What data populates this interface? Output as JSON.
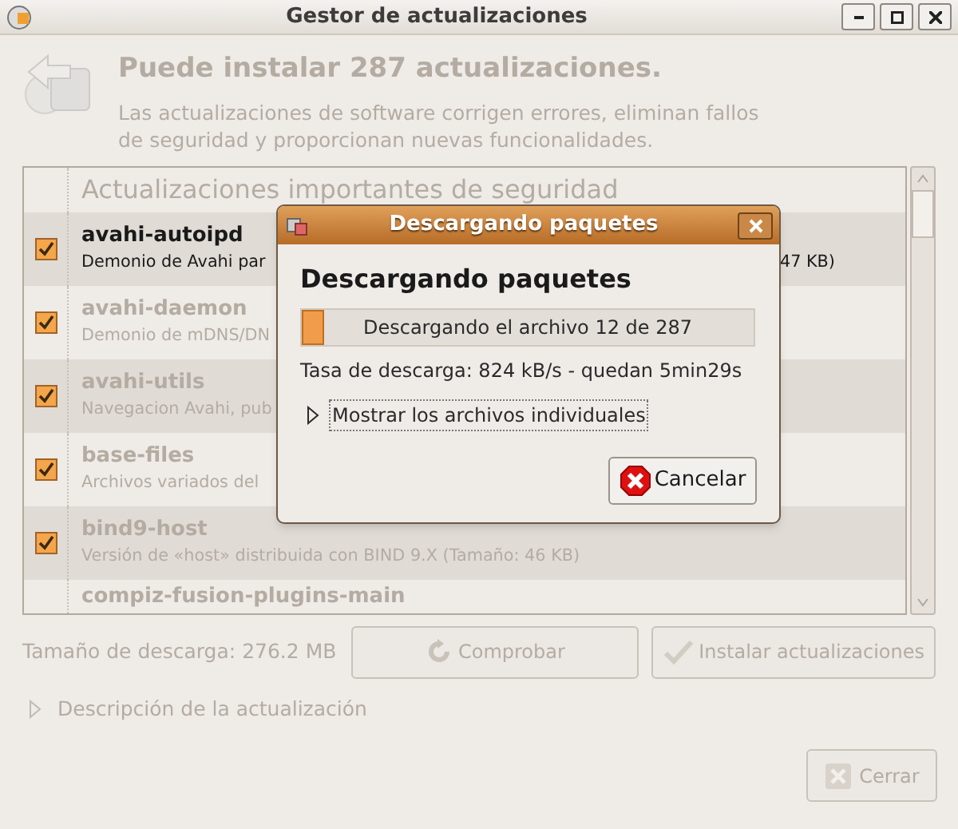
{
  "window": {
    "title": "Gestor de actualizaciones"
  },
  "header": {
    "title": "Puede instalar 287 actualizaciones.",
    "text": "Las actualizaciones de software corrigen errores, eliminan fallos de seguridad y proporcionan nuevas funcionalidades."
  },
  "update_list": {
    "group": "Actualizaciones importantes de seguridad",
    "rows": [
      {
        "name": "avahi-autoipd",
        "description": "Demonio de Avahi par",
        "description_tail": "47 KB)",
        "checked": true,
        "selected": true
      },
      {
        "name": "avahi-daemon",
        "description": "Demonio de mDNS/DN",
        "checked": true,
        "selected": false
      },
      {
        "name": "avahi-utils",
        "description": "Navegacion Avahi, pub",
        "checked": true,
        "selected": false
      },
      {
        "name": "base-files",
        "description": "Archivos variados del",
        "checked": true,
        "selected": false
      },
      {
        "name": "bind9-host",
        "description": "Versión de «host» distribuida con BIND 9.X (Tamaño: 46 KB)",
        "checked": true,
        "selected": false
      }
    ],
    "partial_row": "compiz-fusion-plugins-main"
  },
  "download_size": "Tamaño de descarga: 276.2 MB",
  "buttons": [
    {
      "label": "Comprobar",
      "kind": "refresh"
    },
    {
      "label": "Instalar actualizaciones",
      "kind": "install"
    }
  ],
  "details_expander": {
    "label": "Descripción de la actualización",
    "expanded": false
  },
  "close_button": "Cerrar",
  "dialog": {
    "title": "Descargando paquetes",
    "heading": "Descargando paquetes",
    "progress": {
      "level": 0.05,
      "text": "Descargando el archivo 12 de 287"
    },
    "rate": "Tasa de descarga: 824 kB/s - quedan 5min29s",
    "expander": {
      "label": "Mostrar los archivos individuales",
      "expanded": false
    },
    "cancel": "Cancelar"
  }
}
